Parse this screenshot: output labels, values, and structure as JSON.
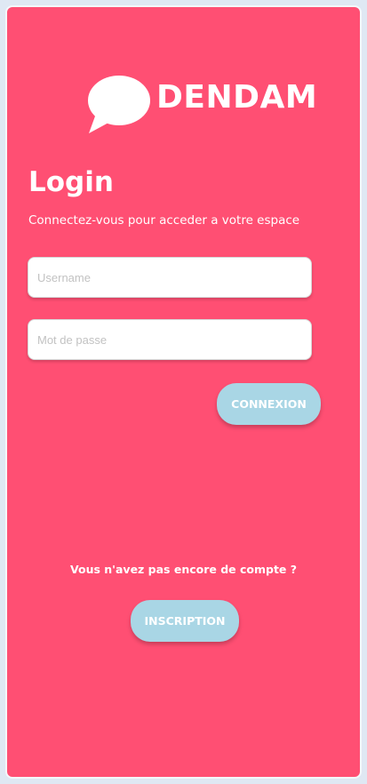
{
  "brand": {
    "name": "DENDAM"
  },
  "login": {
    "title": "Login",
    "subtitle": "Connectez-vous pour acceder a votre espace",
    "username_placeholder": "Username",
    "password_placeholder": "Mot de passe",
    "submit_label": "CONNEXION"
  },
  "signup": {
    "prompt": "Vous n'avez pas encore de compte ?",
    "button_label": "INSCRIPTION"
  },
  "colors": {
    "background": "#ff4f73",
    "button": "#a9d6e5",
    "text": "#ffffff"
  },
  "icons": {
    "logo": "speech-bubble-icon"
  }
}
